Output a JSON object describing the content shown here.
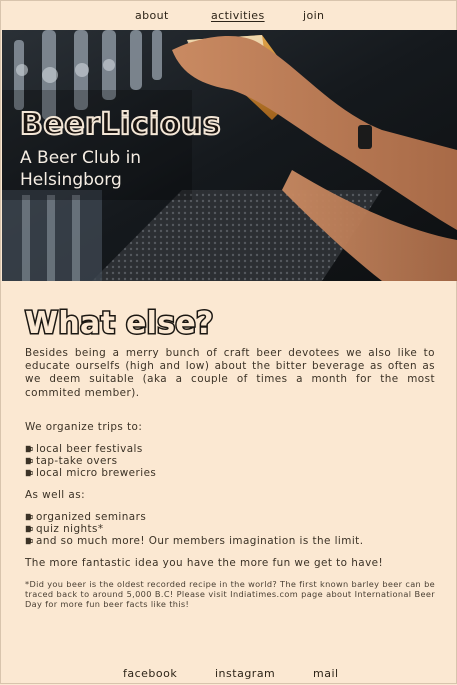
{
  "nav": {
    "about": "about",
    "activities": "activities",
    "join": "join",
    "active": "activities"
  },
  "hero": {
    "title": "BeerLicious",
    "subtitle": "A Beer Club in Helsingborg"
  },
  "main": {
    "heading": "What else?",
    "intro": "Besides being a merry bunch of craft beer devotees we also like to educate ourselfs (high and low) about the bitter beverage as often as we deem suitable (aka a couple of times a month for the most commited member).",
    "trips_intro": "We organize trips to:",
    "trips": [
      "local beer festivals",
      "tap-take overs",
      "local micro breweries"
    ],
    "as_well_as": "As well as:",
    "extras": [
      "organized seminars",
      "quiz nights*",
      "and so much more! Our members imagination is the limit."
    ],
    "closing": "The more fantastic idea you have the more fun we get to have!",
    "footnote": "*Did you beer is the oldest recorded recipe in the world? The first known barley beer can be traced back to around 5,000 B.C! Please visit Indiatimes.com page about International Beer Day for more fun beer facts like this!"
  },
  "footer": {
    "facebook": "facebook",
    "instagram": "instagram",
    "mail": "mail"
  },
  "colors": {
    "background": "#fbe8d2",
    "text": "#3b3226"
  },
  "icons": {
    "list_bullet": "beer-mug-icon"
  }
}
